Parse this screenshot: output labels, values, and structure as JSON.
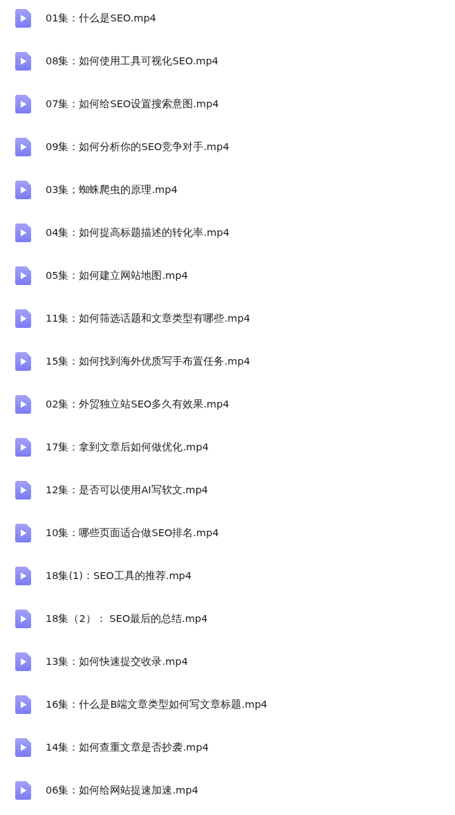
{
  "files": [
    {
      "name": "01集：什么是SEO.mp4"
    },
    {
      "name": "08集：如何使用工具可视化SEO.mp4"
    },
    {
      "name": "07集：如何给SEO设置搜索意图.mp4"
    },
    {
      "name": "09集：如何分析你的SEO竞争对手.mp4"
    },
    {
      "name": "03集；蜘蛛爬虫的原理.mp4"
    },
    {
      "name": "04集：如何提高标题描述的转化率.mp4"
    },
    {
      "name": "05集：如何建立网站地图.mp4"
    },
    {
      "name": "11集：如何筛选话题和文章类型有哪些.mp4"
    },
    {
      "name": "15集：如何找到海外优质写手布置任务.mp4"
    },
    {
      "name": "02集：外贸独立站SEO多久有效果.mp4"
    },
    {
      "name": "17集：拿到文章后如何做优化.mp4"
    },
    {
      "name": "12集：是否可以使用AI写软文.mp4"
    },
    {
      "name": "10集：哪些页面适合做SEO排名.mp4"
    },
    {
      "name": "18集(1)：SEO工具的推荐.mp4"
    },
    {
      "name": "18集（2）： SEO最后的总结.mp4"
    },
    {
      "name": "13集：如何快速提交收录.mp4"
    },
    {
      "name": "16集：什么是B端文章类型如何写文章标题.mp4"
    },
    {
      "name": "14集：如何查重文章是否抄袭.mp4"
    },
    {
      "name": "06集：如何给网站提速加速.mp4"
    }
  ]
}
